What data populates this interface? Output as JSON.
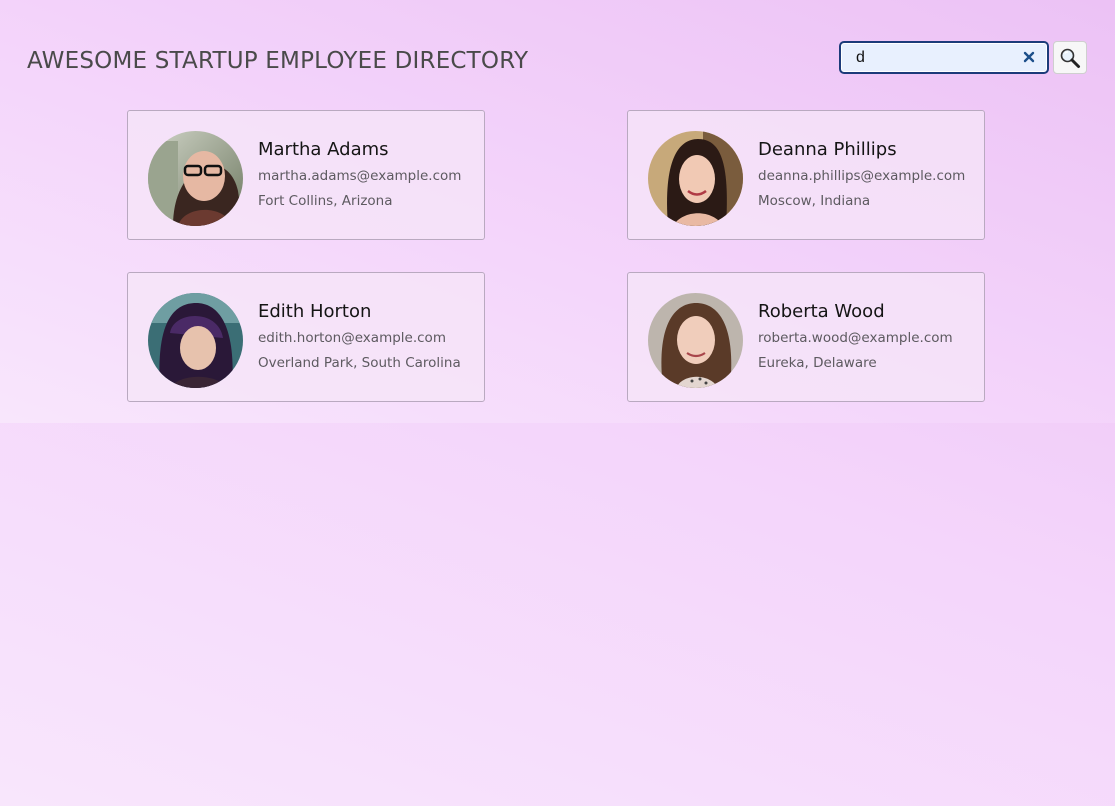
{
  "header": {
    "title": "AWESOME STARTUP EMPLOYEE DIRECTORY"
  },
  "search": {
    "value": "d",
    "clear_icon": "close-icon",
    "button_icon": "search-icon"
  },
  "employees": [
    {
      "name": "Martha Adams",
      "email": "martha.adams@example.com",
      "location": "Fort Collins, Arizona"
    },
    {
      "name": "Deanna Phillips",
      "email": "deanna.phillips@example.com",
      "location": "Moscow, Indiana"
    },
    {
      "name": "Edith Horton",
      "email": "edith.horton@example.com",
      "location": "Overland Park, South Carolina"
    },
    {
      "name": "Roberta Wood",
      "email": "roberta.wood@example.com",
      "location": "Eureka, Delaware"
    }
  ],
  "colors": {
    "accent_border": "#1c3b7a",
    "clear_icon": "#1c4f8a"
  }
}
